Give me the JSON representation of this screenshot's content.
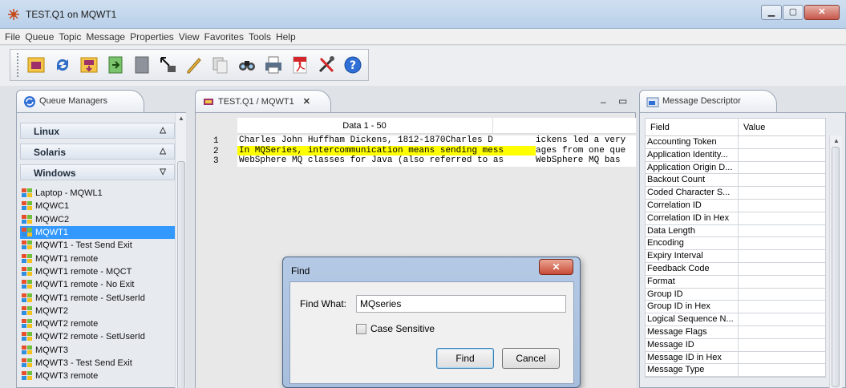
{
  "window": {
    "title": "TEST.Q1 on MQWT1"
  },
  "menu": [
    "File",
    "Queue",
    "Topic",
    "Message",
    "Properties",
    "View",
    "Favorites",
    "Tools",
    "Help"
  ],
  "toolbar_icons": [
    "open-icon",
    "refresh-icon",
    "load-icon",
    "import-icon",
    "export-icon",
    "move-icon",
    "edit-icon",
    "copy-icon",
    "find-icon",
    "print-icon",
    "pdf-icon",
    "tools-icon",
    "help-icon"
  ],
  "queue_managers": {
    "tab_label": "Queue Managers",
    "groups": [
      {
        "label": "Linux",
        "state": "collapsed"
      },
      {
        "label": "Solaris",
        "state": "collapsed"
      },
      {
        "label": "Windows",
        "state": "expanded"
      }
    ],
    "items": [
      "Laptop - MQWL1",
      "MQWC1",
      "MQWC2",
      "MQWT1",
      "MQWT1 - Test Send Exit",
      "MQWT1 remote",
      "MQWT1 remote - MQCT",
      "MQWT1 remote - No Exit",
      "MQWT1 remote - SetUserId",
      "MQWT2",
      "MQWT2 remote",
      "MQWT2 remote - SetUserId",
      "MQWT3",
      "MQWT3 - Test Send Exit",
      "MQWT3 remote"
    ],
    "selected": "MQWT1"
  },
  "data_panel": {
    "tab_label": "TEST.Q1 / MQWT1",
    "column_header": "Data 1 - 50",
    "rows": [
      {
        "num": "1",
        "col1": "Charles John Huffham Dickens, 1812-1870Charles D",
        "col2": "ickens led a very"
      },
      {
        "num": "2",
        "col1": "In MQSeries, intercommunication means sending mess",
        "col2": "ages from one que"
      },
      {
        "num": "3",
        "col1": "WebSphere MQ classes for Java (also referred to as",
        "col2": "WebSphere MQ bas"
      }
    ],
    "highlighted_row": 1
  },
  "descriptor": {
    "tab_label": "Message Descriptor",
    "headers": {
      "field": "Field",
      "value": "Value"
    },
    "fields": [
      "Accounting Token",
      "Application Identity...",
      "Application Origin D...",
      "Backout Count",
      "Coded Character S...",
      "Correlation ID",
      "Correlation ID in Hex",
      "Data Length",
      "Encoding",
      "Expiry Interval",
      "Feedback Code",
      "Format",
      "Group ID",
      "Group ID in Hex",
      "Logical Sequence N...",
      "Message Flags",
      "Message ID",
      "Message ID in Hex",
      "Message Type"
    ]
  },
  "find_dialog": {
    "title": "Find",
    "find_label": "Find What:",
    "find_value": "MQseries",
    "case_sensitive_label": "Case Sensitive",
    "case_sensitive_checked": false,
    "find_button": "Find",
    "cancel_button": "Cancel"
  }
}
